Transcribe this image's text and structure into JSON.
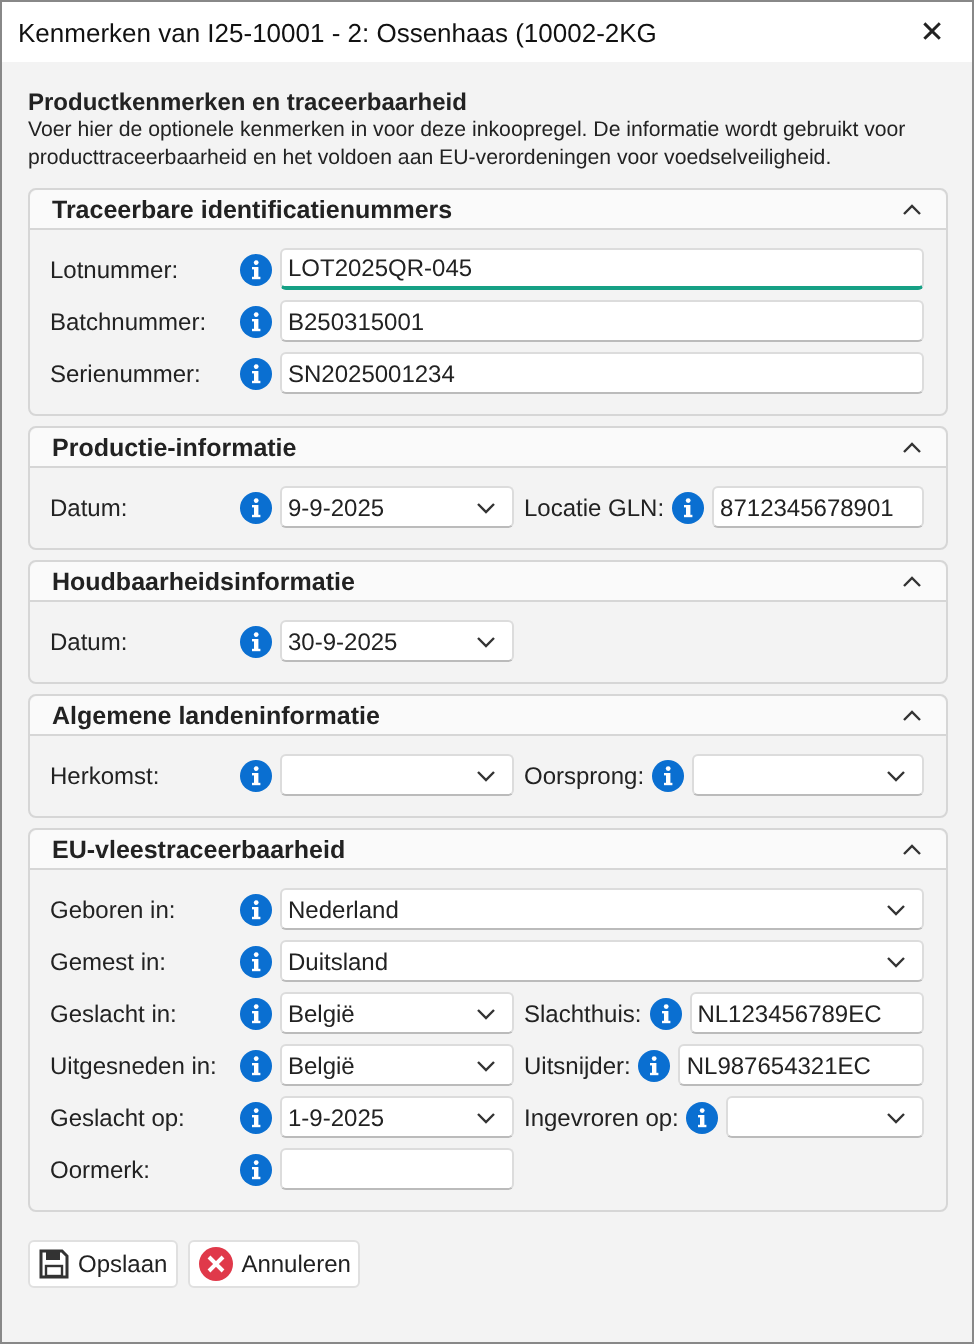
{
  "window": {
    "title": "Kenmerken van I25-10001 - 2: Ossenhaas (10002-2KG",
    "close": "✕"
  },
  "intro": {
    "heading": "Productkenmerken en traceerbaarheid",
    "text": "Voer hier de optionele kenmerken in voor deze inkoopregel. De informatie wordt gebruikt voor producttraceerbaarheid en het voldoen aan EU-verordeningen voor voedselveiligheid."
  },
  "sections": [
    {
      "title": "Traceerbare identificatienummers",
      "expanded": true,
      "rows": [
        [
          {
            "label": "Lotnummer:",
            "kind": "text",
            "value": "LOT2025QR-045",
            "wide": true,
            "focused": true
          }
        ],
        [
          {
            "label": "Batchnummer:",
            "kind": "text",
            "value": "B250315001",
            "wide": true,
            "focused": false
          }
        ],
        [
          {
            "label": "Serienummer:",
            "kind": "text",
            "value": "SN2025001234",
            "wide": true,
            "focused": false
          }
        ]
      ]
    },
    {
      "title": "Productie-informatie",
      "expanded": true,
      "rows": [
        [
          {
            "label": "Datum:",
            "kind": "dropdown",
            "value": "9-9-2025",
            "wide": false,
            "focused": false
          },
          {
            "label": "Locatie GLN:",
            "kind": "text",
            "value": "8712345678901",
            "wide": false,
            "focused": false
          }
        ]
      ]
    },
    {
      "title": "Houdbaarheidsinformatie",
      "expanded": true,
      "rows": [
        [
          {
            "label": "Datum:",
            "kind": "dropdown",
            "value": "30-9-2025",
            "wide": false,
            "focused": false
          }
        ]
      ]
    },
    {
      "title": "Algemene landeninformatie",
      "expanded": true,
      "rows": [
        [
          {
            "label": "Herkomst:",
            "kind": "dropdown",
            "wide": false,
            "focused": false
          },
          {
            "label": "Oorsprong:",
            "kind": "dropdown",
            "wide": false,
            "focused": false
          }
        ]
      ]
    },
    {
      "title": "EU-vleestraceerbaarheid",
      "expanded": true,
      "rows": [
        [
          {
            "label": "Geboren in:",
            "kind": "dropdown",
            "value": "Nederland",
            "wide": true,
            "focused": false
          }
        ],
        [
          {
            "label": "Gemest in:",
            "kind": "dropdown",
            "value": "Duitsland",
            "wide": true,
            "focused": false
          }
        ],
        [
          {
            "label": "Geslacht in:",
            "kind": "dropdown",
            "value": "België",
            "wide": false,
            "focused": false
          },
          {
            "label": "Slachthuis:",
            "kind": "text",
            "value": "NL123456789EC",
            "wide": false,
            "focused": false
          }
        ],
        [
          {
            "label": "Uitgesneden in:",
            "kind": "dropdown",
            "value": "België",
            "wide": false,
            "focused": false
          },
          {
            "label": "Uitsnijder:",
            "kind": "text",
            "value": "NL987654321EC",
            "wide": false,
            "focused": false
          }
        ],
        [
          {
            "label": "Geslacht op:",
            "kind": "dropdown",
            "value": "1-9-2025",
            "wide": false,
            "focused": false
          },
          {
            "label": "Ingevroren op:",
            "kind": "dropdown",
            "wide": false,
            "focused": false
          }
        ],
        [
          {
            "label": "Oormerk:",
            "kind": "text",
            "wide": false,
            "focused": false
          }
        ]
      ]
    }
  ],
  "buttons": [
    {
      "kind": "save",
      "label": "Opslaan"
    },
    {
      "kind": "cancel",
      "label": "Annuleren"
    }
  ]
}
